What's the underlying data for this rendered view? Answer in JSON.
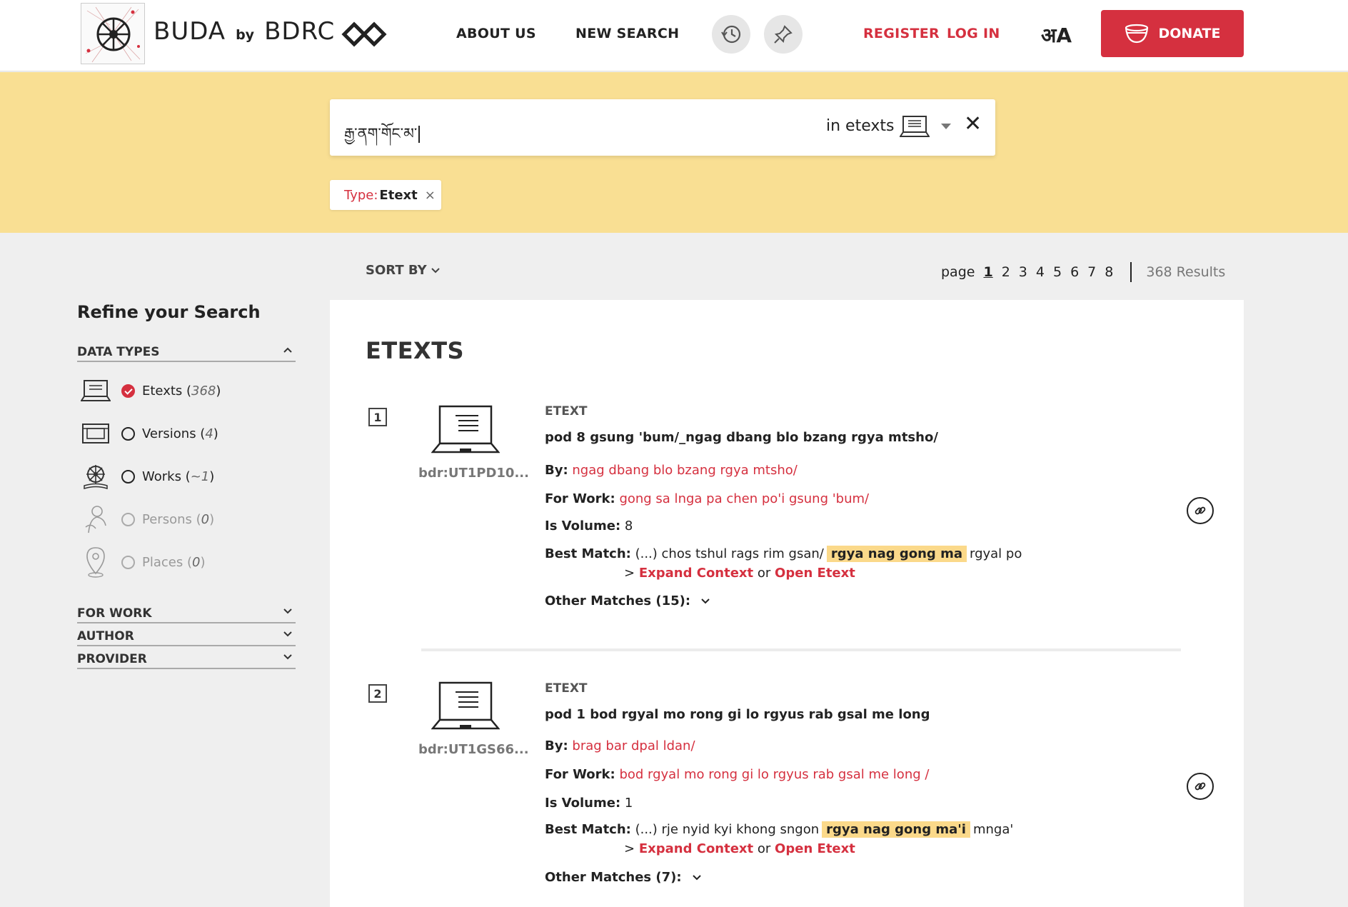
{
  "header": {
    "brand_name": "BUDA",
    "brand_by": "by",
    "brand_org": "BDRC",
    "nav_about": "ABOUT US",
    "nav_new_search": "NEW SEARCH",
    "register": "REGISTER",
    "login": "LOG IN",
    "lang_glyph": "अA",
    "donate": "DONATE",
    "accent_color": "#d5303f"
  },
  "search": {
    "query": "རྒྱ་ནག་གོང་མ་",
    "scope": "in etexts",
    "scope_icon": "laptop-icon",
    "clear_icon": "close-icon"
  },
  "filter_chip": {
    "key": "Type:",
    "value": "Etext",
    "remove": "×"
  },
  "toolbar": {
    "sort_label": "SORT BY",
    "page_label": "page",
    "pages": [
      "1",
      "2",
      "3",
      "4",
      "5",
      "6",
      "7",
      "8"
    ],
    "current_page": "1",
    "results": "368 Results"
  },
  "sidebar": {
    "title": "Refine your Search",
    "data_types_label": "DATA TYPES",
    "items": [
      {
        "label": "Etexts (",
        "count": "368",
        "close": ")",
        "checked": true,
        "icon": "laptop-icon"
      },
      {
        "label": "Versions (",
        "count": "4",
        "close": ")",
        "checked": false,
        "icon": "book-box-icon"
      },
      {
        "label": "Works (",
        "count": "~1",
        "close": ")",
        "checked": false,
        "icon": "dharma-wheel-icon"
      },
      {
        "label": "Persons (",
        "count": "0",
        "close": ")",
        "checked": false,
        "icon": "person-icon"
      },
      {
        "label": "Places (",
        "count": "0",
        "close": ")",
        "checked": false,
        "icon": "map-pin-icon"
      }
    ],
    "for_work": "FOR WORK",
    "author": "AUTHOR",
    "provider": "PROVIDER"
  },
  "results": {
    "section_title": "ETEXTS",
    "items": [
      {
        "num": "1",
        "id": "bdr:UT1PD10...",
        "type": "ETEXT",
        "title": "pod 8 gsung 'bum/_ngag dbang blo bzang rgya mtsho/",
        "by_label": "By:",
        "by": "ngag dbang blo bzang rgya mtsho/",
        "work_label": "For Work:",
        "work": "gong sa lnga pa chen po'i gsung 'bum/",
        "vol_label": "Is Volume:",
        "vol": "8",
        "match_label": "Best Match:",
        "match_pre": "(...) chos tshul rags rim gsan/",
        "match_hl": "rgya nag gong ma",
        "match_post": "rgyal po",
        "ctx_prefix": ">",
        "expand": "Expand Context",
        "or": "or",
        "open": "Open Etext",
        "other": "Other Matches (15):"
      },
      {
        "num": "2",
        "id": "bdr:UT1GS66...",
        "type": "ETEXT",
        "title": "pod 1 bod rgyal mo rong gi lo rgyus rab gsal me long",
        "by_label": "By:",
        "by": "brag bar dpal ldan/",
        "work_label": "For Work:",
        "work": "bod rgyal mo rong gi lo rgyus rab gsal me long /",
        "vol_label": "Is Volume:",
        "vol": "1",
        "match_label": "Best Match:",
        "match_pre": "(...) rje nyid kyi khong sngon",
        "match_hl": "rgya nag gong ma'i",
        "match_post": "mnga'",
        "ctx_prefix": ">",
        "expand": "Expand Context",
        "or": "or",
        "open": "Open Etext",
        "other": "Other Matches (7):"
      }
    ]
  }
}
